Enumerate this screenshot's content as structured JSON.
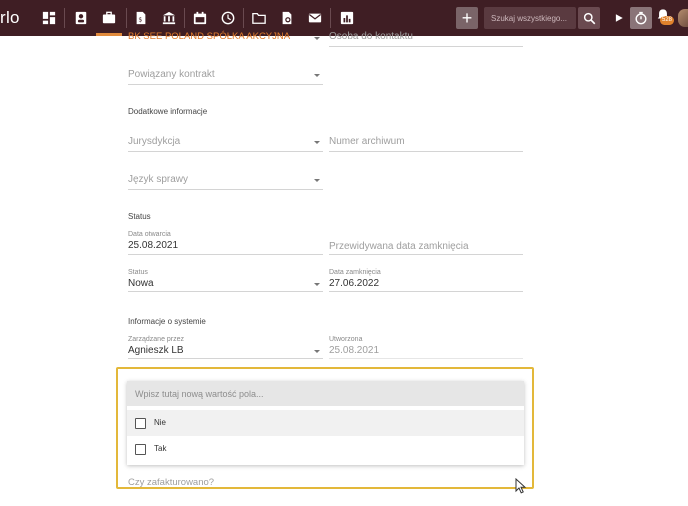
{
  "app": {
    "logo_text": "rlo"
  },
  "topbar": {
    "icons": [
      "dashboard-icon",
      "contacts-icon",
      "briefcase-icon",
      "document-icon",
      "bank-icon",
      "calendar-icon",
      "history-icon",
      "folder-icon",
      "invoice-icon",
      "mail-icon",
      "reports-icon"
    ],
    "add_label": "+",
    "search_placeholder": "Szukaj wszystkiego...",
    "notification_count": "528",
    "accent_color": "#e08a3c",
    "bar_color": "#3f1e24"
  },
  "form": {
    "client_value": "BK SEE POLAND SPÓŁKA AKCYJNA",
    "contact_person_placeholder": "Osoba do kontaktu",
    "related_contract_placeholder": "Powiązany kontrakt",
    "additional_info_title": "Dodatkowe informacje",
    "jurisdiction_placeholder": "Jurysdykcja",
    "archive_number_placeholder": "Numer archiwum",
    "case_language_placeholder": "Język sprawy",
    "status_title": "Status",
    "open_date_label": "Data otwarcia",
    "open_date_value": "25.08.2021",
    "expected_close_placeholder": "Przewidywana data zamknięcia",
    "status_label": "Status",
    "status_value": "Nowa",
    "close_date_label": "Data zamknięcia",
    "close_date_value": "27.06.2022",
    "system_info_title": "Informacje o systemie",
    "managed_by_label": "Zarządzane przez",
    "managed_by_value": "Agnieszk LB",
    "created_label": "Utworzona",
    "created_value": "25.08.2021",
    "invoiced_placeholder": "Czy zafakturowano?"
  },
  "dropdown": {
    "search_placeholder": "Wpisz tutaj nową wartość pola...",
    "options": [
      {
        "label": "Nie",
        "checked": false
      },
      {
        "label": "Tak",
        "checked": false
      }
    ],
    "highlight_color": "#e3b83a"
  }
}
